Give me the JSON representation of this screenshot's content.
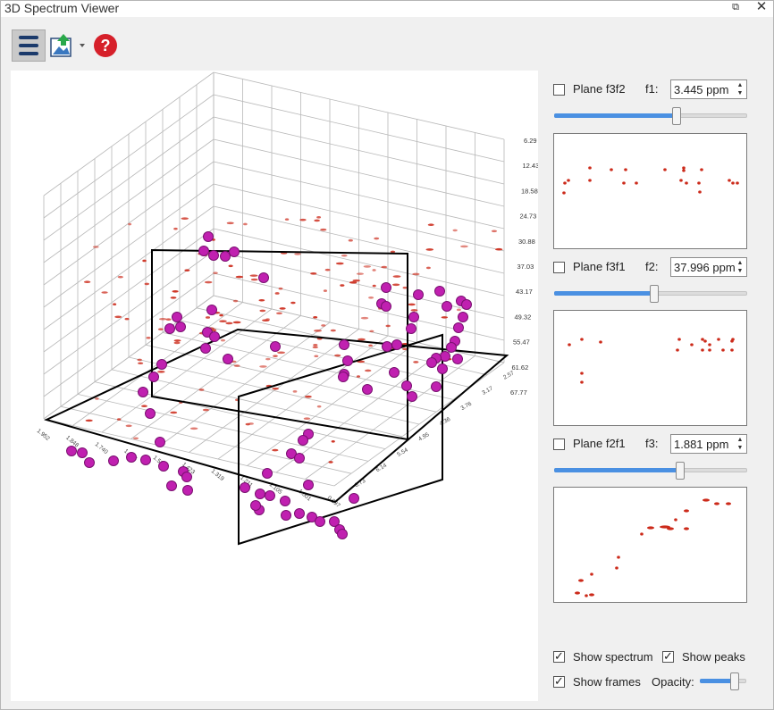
{
  "window": {
    "title": "3D Spectrum Viewer",
    "restore_glyph": "⧉",
    "close_glyph": "✕"
  },
  "toolbar": {
    "menu_icon": "hamburger-menu-icon",
    "export_icon": "image-export-icon",
    "help_icon": "help-question-icon"
  },
  "colors": {
    "peak": "#c020b0",
    "peak_dark": "#7a1070",
    "spectrum": "#cc2a1a",
    "accent": "#4a90e2",
    "frame": "#000000",
    "grid": "#b8b8b8"
  },
  "axes": {
    "right_ticks": [
      "6.29",
      "12.43",
      "18.58",
      "24.73",
      "30.88",
      "37.03",
      "43.17",
      "49.32",
      "55.47",
      "61.62",
      "67.77"
    ],
    "front_ticks": [
      "2.57",
      "3.17",
      "3.76",
      "4.36",
      "4.95",
      "5.54",
      "6.14",
      "6.73"
    ],
    "left_ticks": [
      "1.952",
      "1.848",
      "1.740",
      "1.637",
      "1.530",
      "1.423",
      "1.319",
      "1.211",
      "1.105",
      "1.001",
      "0.897"
    ]
  },
  "planes": [
    {
      "label": "Plane f3f2",
      "checked": false,
      "axis": "f1:",
      "value": "3.445 ppm",
      "slider_fraction": 0.64
    },
    {
      "label": "Plane f3f1",
      "checked": false,
      "axis": "f2:",
      "value": "37.996 ppm",
      "slider_fraction": 0.52
    },
    {
      "label": "Plane f2f1",
      "checked": false,
      "axis": "f3:",
      "value": "1.881 ppm",
      "slider_fraction": 0.66
    }
  ],
  "options": {
    "show_spectrum": {
      "label": "Show spectrum",
      "checked": true
    },
    "show_peaks": {
      "label": "Show peaks",
      "checked": true
    },
    "show_frames": {
      "label": "Show frames",
      "checked": true
    },
    "opacity": {
      "label": "Opacity:",
      "fraction": 0.82
    }
  }
}
